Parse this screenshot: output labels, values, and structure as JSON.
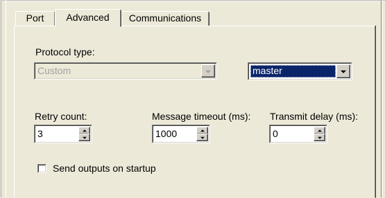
{
  "tabs": {
    "port": "Port",
    "advanced": "Advanced",
    "communications": "Communications",
    "active": "Advanced"
  },
  "protocol": {
    "label": "Protocol type:",
    "type_value": "Custom",
    "type_enabled": false,
    "mode_value": "master",
    "mode_selected_color": "#0a246a"
  },
  "retry": {
    "label": "Retry count:",
    "value": "3"
  },
  "timeout": {
    "label": "Message timeout (ms):",
    "value": "1000"
  },
  "transmit": {
    "label": "Transmit delay (ms):",
    "value": "0"
  },
  "options": {
    "send_outputs_label": "Send outputs on startup",
    "send_outputs_checked": false
  },
  "icons": {
    "dropdown": "chevron-down-icon",
    "spin_up": "spin-up-icon",
    "spin_down": "spin-down-icon"
  }
}
